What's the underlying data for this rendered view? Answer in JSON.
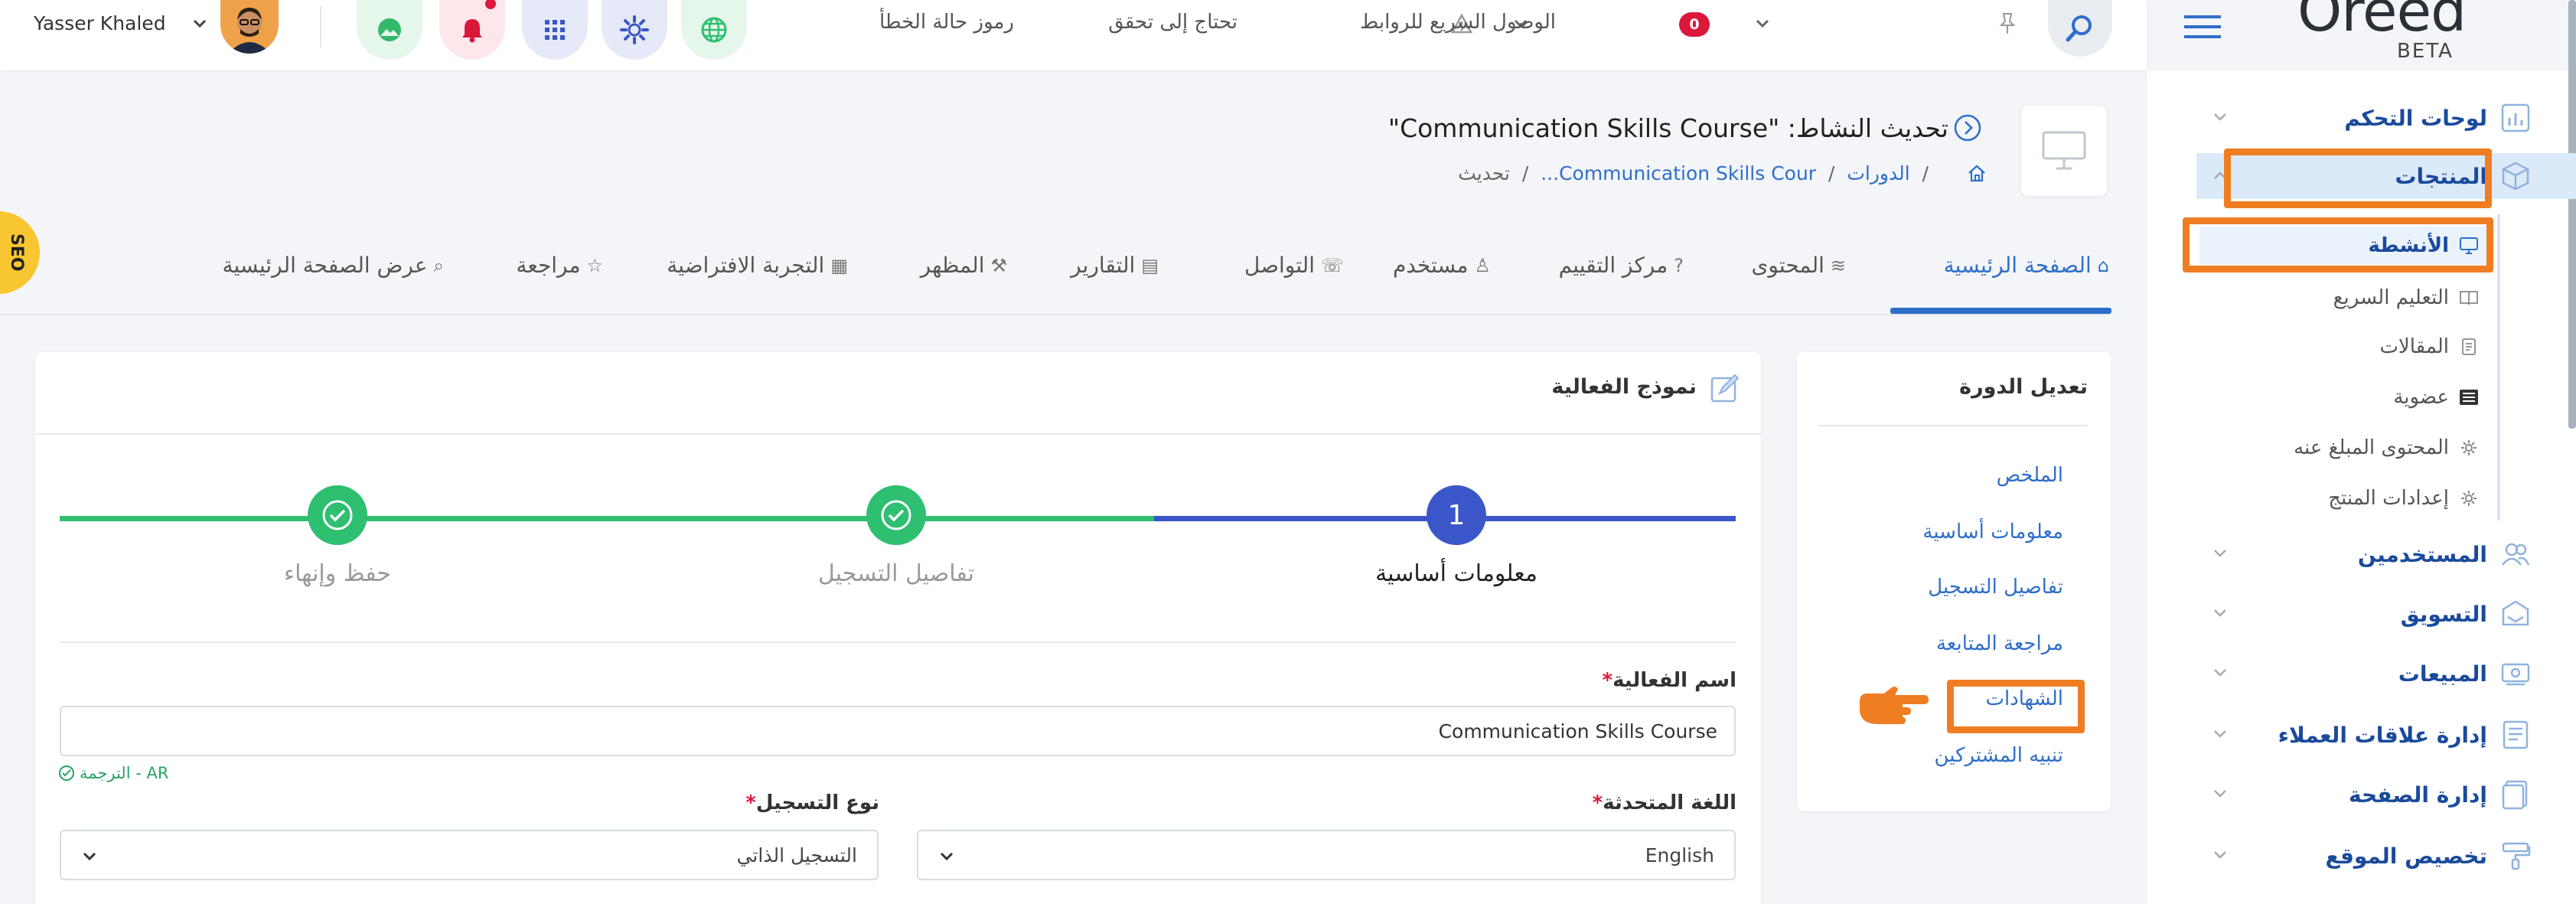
{
  "topbar": {
    "user_name": "Yasser Khaled",
    "error_codes": "رموز حالة الخطأ",
    "needs_check": "تحتاج إلى تحقق",
    "needs_check_count": "0",
    "quick_links": "الوصول السريع للروابط",
    "icons": [
      "globe-icon",
      "gear-icon",
      "grid-icon",
      "bell-icon",
      "mountain-icon"
    ]
  },
  "logo": {
    "text": "Oreed",
    "beta": "BETA"
  },
  "header": {
    "title": "تحديث النشاط: \"Communication Skills Course\"",
    "breadcrumb": {
      "level1": "الدورات",
      "level2": "Communication Skills Cour...",
      "current": "تحديث",
      "sep": "/"
    }
  },
  "seo_tab": "SEO",
  "sidebar": {
    "items": [
      {
        "label": "لوحات التحكم",
        "icon": "chart-icon"
      },
      {
        "label": "المنتجات",
        "icon": "box-icon"
      },
      {
        "label": "المستخدمين",
        "icon": "users-icon"
      },
      {
        "label": "التسويق",
        "icon": "marketing-icon"
      },
      {
        "label": "المبيعات",
        "icon": "sales-icon"
      },
      {
        "label": "إدارة علاقات العملاء",
        "icon": "crm-icon"
      },
      {
        "label": "إدارة الصفحة",
        "icon": "page-icon"
      },
      {
        "label": "تخصيص الموقع",
        "icon": "brush-icon"
      }
    ],
    "subitems": [
      {
        "label": "الأنشطة",
        "icon": "monitor-icon"
      },
      {
        "label": "التعليم السريع",
        "icon": "book-icon"
      },
      {
        "label": "المقالات",
        "icon": "article-icon"
      },
      {
        "label": "عضوية",
        "icon": "membership-icon"
      },
      {
        "label": "المحتوى المبلغ عنه",
        "icon": "gear-icon"
      },
      {
        "label": "إعدادات المنتج",
        "icon": "gear-icon"
      }
    ]
  },
  "tabs": [
    {
      "label": "الصفحة الرئيسية",
      "icon": "⌂"
    },
    {
      "label": "المحتوى",
      "icon": "≋"
    },
    {
      "label": "مركز التقييم",
      "icon": "?"
    },
    {
      "label": "مستخدم",
      "icon": "♙"
    },
    {
      "label": "التواصل",
      "icon": "☏"
    },
    {
      "label": "التقارير",
      "icon": "▤"
    },
    {
      "label": "المظهر",
      "icon": "⚒"
    },
    {
      "label": "التجربة الافتراضية",
      "icon": "▦"
    },
    {
      "label": "مراجعة",
      "icon": "☆"
    },
    {
      "label": "عرض الصفحة الرئيسية",
      "icon": "⌕"
    }
  ],
  "edit_course": {
    "title": "تعديل الدورة",
    "links": [
      "الملخص",
      "معلومات أساسية",
      "تفاصيل التسجيل",
      "مراجعة المتابعة",
      "الشهادات",
      "تنبيه المشتركين"
    ]
  },
  "form": {
    "title": "نموذج الفعالية",
    "steps": [
      {
        "number": "1",
        "label": "معلومات أساسية"
      },
      {
        "label": "تفاصيل التسجيل"
      },
      {
        "label": "حفظ وإنهاء"
      }
    ],
    "event_name_label": "اسم الفعالية",
    "required_mark": "*",
    "event_name_value": "Communication Skills Course",
    "translation": "الترجمة - AR",
    "language_label": "اللغة المتحدثة",
    "language_value": "English",
    "registration_label": "نوع التسجيل",
    "registration_value": "التسجيل الذاتي"
  },
  "colors": {
    "accent": "#2f6fc9",
    "success": "#2fbf71",
    "highlight": "#ef7d22",
    "danger": "#d9183b"
  }
}
